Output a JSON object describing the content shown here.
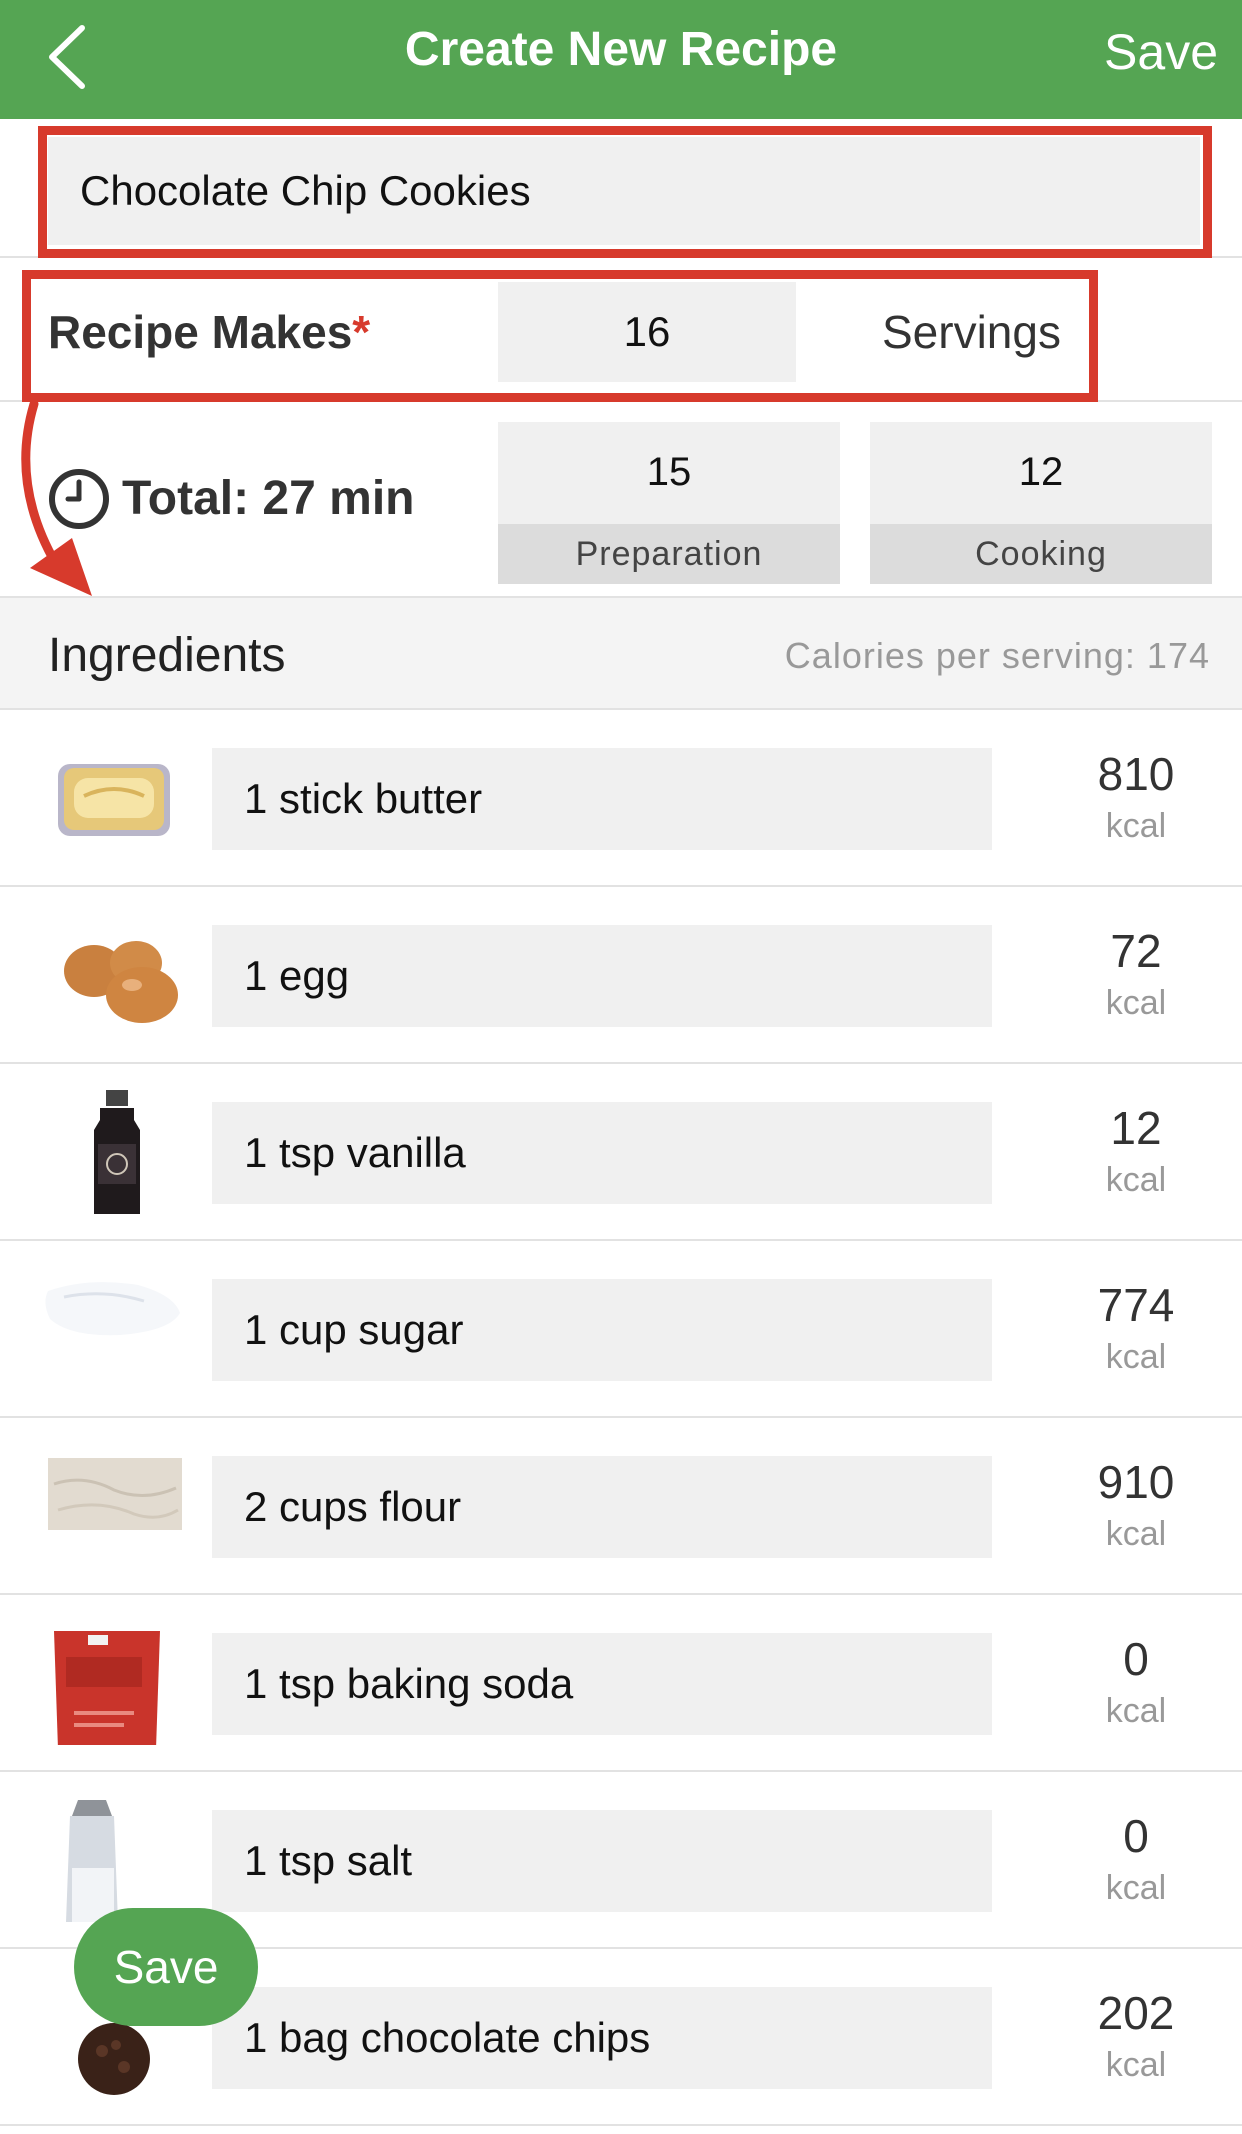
{
  "header": {
    "title": "Create New Recipe",
    "save_label": "Save",
    "back_icon": "chevron-left-icon"
  },
  "recipe": {
    "name": "Chocolate Chip Cookies"
  },
  "makes": {
    "label": "Recipe Makes",
    "required_mark": "*",
    "servings": "16",
    "unit": "Servings"
  },
  "time": {
    "total_label": "Total: 27 min",
    "preparation": {
      "value": "15",
      "label": "Preparation"
    },
    "cooking": {
      "value": "12",
      "label": "Cooking"
    }
  },
  "ingredients_header": {
    "title": "Ingredients",
    "calories_per_serving": "Calories per serving: 174"
  },
  "ingredients": [
    {
      "text": "1 stick butter",
      "kcal": "810",
      "unit": "kcal",
      "thumb": "butter"
    },
    {
      "text": "1 egg",
      "kcal": "72",
      "unit": "kcal",
      "thumb": "egg"
    },
    {
      "text": "1 tsp vanilla",
      "kcal": "12",
      "unit": "kcal",
      "thumb": "vanilla"
    },
    {
      "text": "1 cup sugar",
      "kcal": "774",
      "unit": "kcal",
      "thumb": "sugar"
    },
    {
      "text": "2 cups flour",
      "kcal": "910",
      "unit": "kcal",
      "thumb": "flour"
    },
    {
      "text": "1 tsp baking soda",
      "kcal": "0",
      "unit": "kcal",
      "thumb": "baking-soda"
    },
    {
      "text": "1 tsp salt",
      "kcal": "0",
      "unit": "kcal",
      "thumb": "salt"
    },
    {
      "text": "1 bag chocolate chips",
      "kcal": "202",
      "unit": "kcal",
      "thumb": "chocolate-chips"
    }
  ],
  "floating_save_label": "Save",
  "colors": {
    "header_green": "#55a553",
    "annotation_red": "#d73a2c",
    "field_gray": "#f0f0f0"
  }
}
